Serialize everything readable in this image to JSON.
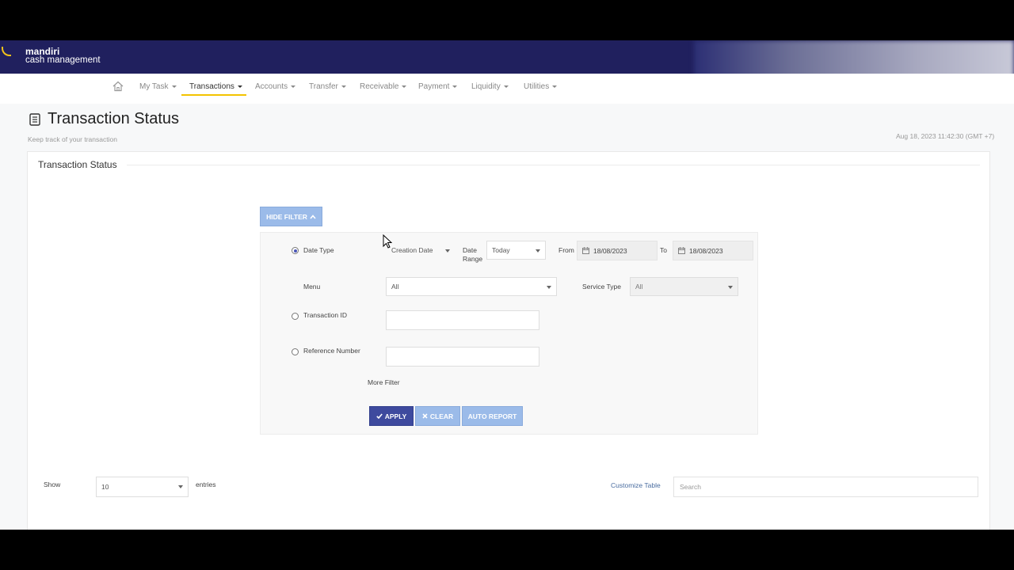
{
  "brand": {
    "line1": "mandiri",
    "line2": "cash management"
  },
  "nav": {
    "items": [
      {
        "label": "My Task"
      },
      {
        "label": "Transactions"
      },
      {
        "label": "Accounts"
      },
      {
        "label": "Transfer"
      },
      {
        "label": "Receivable"
      },
      {
        "label": "Payment"
      },
      {
        "label": "Liquidity"
      },
      {
        "label": "Utilities"
      }
    ],
    "active": "Transactions"
  },
  "page": {
    "title": "Transaction Status",
    "subtitle": "Keep track of your transaction",
    "timestamp": "Aug 18, 2023 11:42:30 (GMT +7)"
  },
  "card": {
    "title": "Transaction Status"
  },
  "filter": {
    "toggle_label": "HIDE FILTER",
    "date_type_label": "Date Type",
    "date_type_value": "Creation Date",
    "date_range_label_1": "Date",
    "date_range_label_2": "Range",
    "date_range_value": "Today",
    "from_label": "From",
    "from_value": "18/08/2023",
    "to_label": "To",
    "to_value": "18/08/2023",
    "menu_label": "Menu",
    "menu_value": "All",
    "service_type_label": "Service Type",
    "service_type_value": "All",
    "transaction_id_label": "Transaction ID",
    "transaction_id_value": "",
    "reference_number_label": "Reference Number",
    "reference_number_value": "",
    "selected_mode": "Date Type",
    "more_filter": "More Filter",
    "apply": "APPLY",
    "clear": "CLEAR",
    "auto_report": "AUTO REPORT"
  },
  "table_controls": {
    "show_label": "Show",
    "page_size": "10",
    "entries_label": "entries",
    "customize_label": "Customize Table",
    "search_placeholder": "Search"
  },
  "colors": {
    "header_bg": "#20205e",
    "accent_yellow": "#f3c300",
    "primary_button": "#3e4a9e",
    "light_button": "#9bbbe9"
  }
}
